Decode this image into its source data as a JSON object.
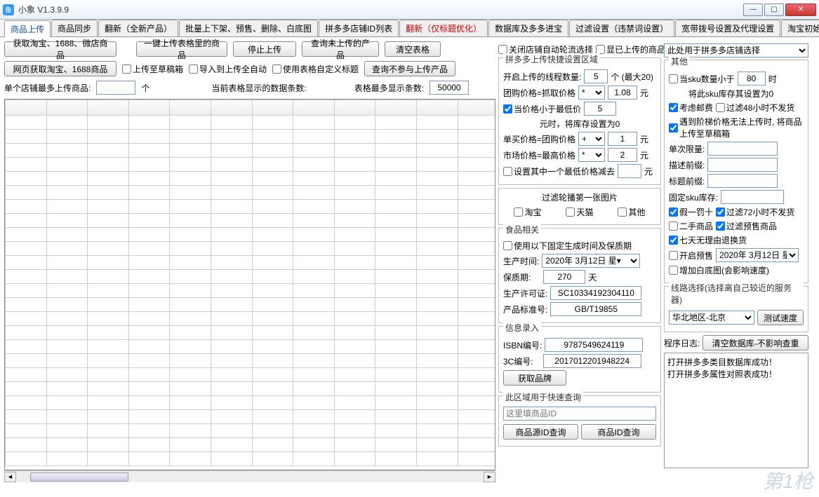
{
  "window": {
    "title": "小象 V1.3.9.9"
  },
  "tabs": [
    "商品上传",
    "商品同步",
    "翻新（全新产品）",
    "批量上下架、预售、删除、白底图",
    "拼多多店铺ID列表",
    "翻新（仅标题优化）",
    "数据库及多多进宝",
    "过滤设置（违禁词设置）",
    "宽带拨号设置及代理设置",
    "淘宝初始化"
  ],
  "toolbar": {
    "btn_get_taobao": "获取淘宝、1688、微店商品",
    "btn_one_click": "一键上传表格里的商品",
    "btn_stop": "停止上传",
    "btn_query_not": "查询未上传的产品",
    "btn_clear": "清空表格",
    "btn_web_taobao": "网页获取淘宝、1688商品",
    "cb_upload_draft": "上传至草稿箱",
    "cb_import_auto": "导入到上传全自动",
    "cb_use_custom_title": "使用表格自定义标题",
    "btn_query_skip": "查询不参与上传产品",
    "lbl_single_shop_max": "单个店铺最多上传商品:",
    "val_single_shop_max": "",
    "unit_ge": "个",
    "lbl_current_rows": "当前表格显示的数据条数:",
    "lbl_max_rows": "表格最多显示条数:",
    "val_max_rows": "50000"
  },
  "midtop": {
    "cb_close_auto": "关闭店铺自动轮流选择",
    "cb_show_uploaded": "显已上传的商品"
  },
  "pdd": {
    "title": "拼多多上传快捷设置区域",
    "lbl_threads": "开启上传的线程数量:",
    "val_threads": "5",
    "threads_suffix": "个 (最大20)",
    "lbl_group_price": "团购价格=抓取价格",
    "op1_sel": "*",
    "op1_val": "1.08",
    "yuan": "元",
    "cb_min_price": "当价格小于最低价",
    "val_min_price": "5",
    "txt_stock_zero": "元时，将库存设置为0",
    "lbl_single_price": "单买价格=团购价格",
    "op2_sel": "+",
    "op2_val": "1",
    "lbl_market_price": "市场价格=最高价格",
    "op3_sel": "*",
    "op3_val": "2",
    "cb_set_minus": "设置其中一个最低价格减去",
    "minus_val": ""
  },
  "filter": {
    "title": "过滤轮播第一张图片",
    "cb_taobao": "淘宝",
    "cb_tmall": "天猫",
    "cb_other": "其他"
  },
  "food": {
    "title": "食品相关",
    "cb_fixed_time": "使用以下固定生成时间及保质期",
    "lbl_prod_date": "生产时间:",
    "val_prod_date": "2020年 3月12日 星▾",
    "lbl_shelf": "保质期:",
    "val_shelf": "270",
    "unit_day": "天",
    "lbl_license": "生产许可证:",
    "val_license": "SC10334192304110",
    "lbl_standard": "产品标准号:",
    "val_standard": "GB/T19855"
  },
  "info": {
    "title": "信息录入",
    "lbl_isbn": "ISBN编号:",
    "val_isbn": "9787549624119",
    "lbl_3c": "3C编号:",
    "val_3c": "2017012201948224",
    "btn_brand": "获取品牌"
  },
  "quick": {
    "title": "此区域用于快速查询",
    "placeholder": "这里填商品ID",
    "btn_src": "商品源ID查询",
    "btn_id": "商品ID查询"
  },
  "righttop": {
    "sel_shop": "此处用于拼多多店铺选择"
  },
  "other": {
    "title": "其他",
    "cb_sku_lt": "当sku数量小于",
    "val_sku_lt": "80",
    "suffix_time": "时",
    "txt_sku_zero": "将此sku库存其设置为0",
    "cb_kaolu": "考虑邮费",
    "cb_48h": "过滤48小时不发货",
    "cb_ladder": "遇到阶梯价格无法上传时, 将商品上传至草稿箱",
    "lbl_single_limit": "单次限量:",
    "val_single_limit": "",
    "lbl_desc_prefix": "描述前缀:",
    "val_desc_prefix": "",
    "lbl_title_prefix": "标题前缀:",
    "val_title_prefix": "",
    "lbl_fixed_sku": "固定sku库存:",
    "val_fixed_sku": "",
    "cb_jiayi": "假一罚十",
    "cb_72h": "过滤72小时不发货",
    "cb_second": "二手商品",
    "cb_presale_filter": "过滤预售商品",
    "cb_7day": "七天无理由退换货",
    "cb_presale": "开启预售",
    "val_presale_date": "2020年 3月12日 星▾",
    "cb_whitebg": "增加白底图(会影响速度)"
  },
  "route": {
    "title": "线路选择(选择离自己较近的服务器)",
    "sel": "华北地区-北京",
    "btn_test": "测试速度"
  },
  "log": {
    "lbl": "程序日志:",
    "btn_clear": "清空数据库-不影响查重",
    "content": "打开拼多多类目数据库成功！\n打开拼多多属性对照表成功！"
  }
}
